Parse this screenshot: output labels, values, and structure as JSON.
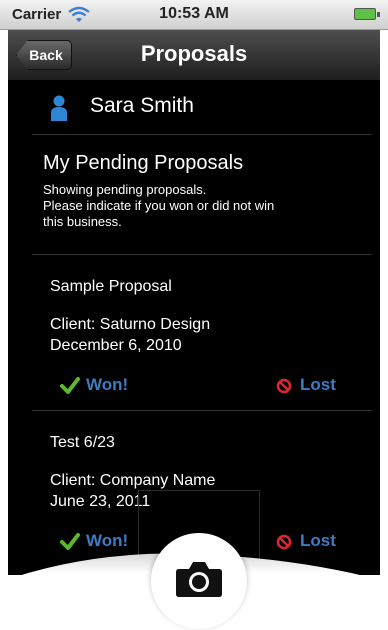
{
  "status_bar": {
    "carrier": "Carrier",
    "time": "10:53 AM",
    "wifi_icon": "wifi-icon",
    "battery_icon": "battery-icon"
  },
  "nav": {
    "back_label": "Back",
    "title": "Proposals"
  },
  "user": {
    "name": "Sara Smith",
    "icon": "person-icon"
  },
  "section": {
    "title": "My Pending Proposals",
    "description_lines": [
      "Showing pending proposals.",
      "Please indicate if you won or did not win",
      "this business."
    ]
  },
  "proposals": [
    {
      "name": "Sample Proposal",
      "client": "Client:  Saturno Design",
      "date": "December 6, 2010",
      "won_label": "Won!",
      "lost_label": "Lost"
    },
    {
      "name": "Test 6/23",
      "client": "Client:  Company Name",
      "date": "June 23, 2011",
      "won_label": "Won!",
      "lost_label": "Lost"
    }
  ],
  "camera": {
    "icon": "camera-icon"
  },
  "colors": {
    "action_blue": "#3f7bc1",
    "won_green": "#5cb82c",
    "lost_red": "#d9272e",
    "user_icon_blue": "#2f86d6"
  }
}
